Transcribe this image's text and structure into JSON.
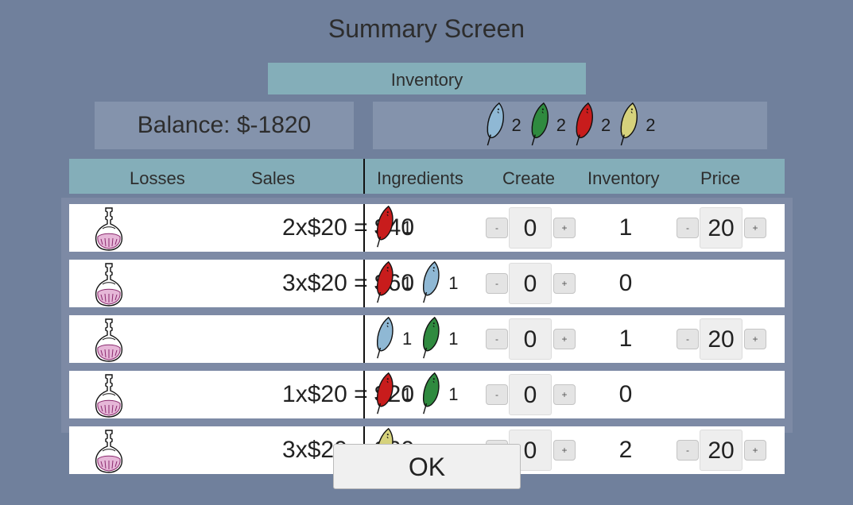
{
  "title": "Summary Screen",
  "inventory_header": "Inventory",
  "balance": "Balance: $-1820",
  "stock": [
    {
      "icon": "blue-leaf-icon",
      "color": "#8fb8d4",
      "count": "2"
    },
    {
      "icon": "green-leaf-icon",
      "color": "#2f8a3f",
      "count": "2"
    },
    {
      "icon": "red-leaf-icon",
      "color": "#c81c1c",
      "count": "2"
    },
    {
      "icon": "yellow-leaf-icon",
      "color": "#d6d27c",
      "count": "2"
    }
  ],
  "columns": {
    "losses": "Losses",
    "sales": "Sales",
    "ingredients": "Ingredients",
    "create": "Create",
    "inventory": "Inventory",
    "price": "Price"
  },
  "stepper": {
    "minus": "-",
    "plus": "+"
  },
  "rows": [
    {
      "sales": "2x$20 = $40",
      "ingredients": [
        {
          "icon": "red-leaf-icon",
          "color": "#c81c1c",
          "count": "1"
        }
      ],
      "create": "0",
      "inventory": "1",
      "price": "20"
    },
    {
      "sales": "3x$20 = $60",
      "ingredients": [
        {
          "icon": "red-leaf-icon",
          "color": "#c81c1c",
          "count": "1"
        },
        {
          "icon": "blue-leaf-icon",
          "color": "#8fb8d4",
          "count": "1"
        }
      ],
      "create": "0",
      "inventory": "0",
      "price": ""
    },
    {
      "sales": "",
      "ingredients": [
        {
          "icon": "blue-leaf-icon",
          "color": "#8fb8d4",
          "count": "1"
        },
        {
          "icon": "green-leaf-icon",
          "color": "#2f8a3f",
          "count": "1"
        }
      ],
      "create": "0",
      "inventory": "1",
      "price": "20"
    },
    {
      "sales": "1x$20 = $20",
      "ingredients": [
        {
          "icon": "red-leaf-icon",
          "color": "#c81c1c",
          "count": "1"
        },
        {
          "icon": "green-leaf-icon",
          "color": "#2f8a3f",
          "count": "1"
        }
      ],
      "create": "0",
      "inventory": "0",
      "price": ""
    },
    {
      "sales": "3x$20 = $60",
      "ingredients": [
        {
          "icon": "yellow-leaf-icon",
          "color": "#d6d27c",
          "count": ""
        }
      ],
      "create": "0",
      "inventory": "2",
      "price": "20"
    }
  ],
  "ok_label": "OK"
}
